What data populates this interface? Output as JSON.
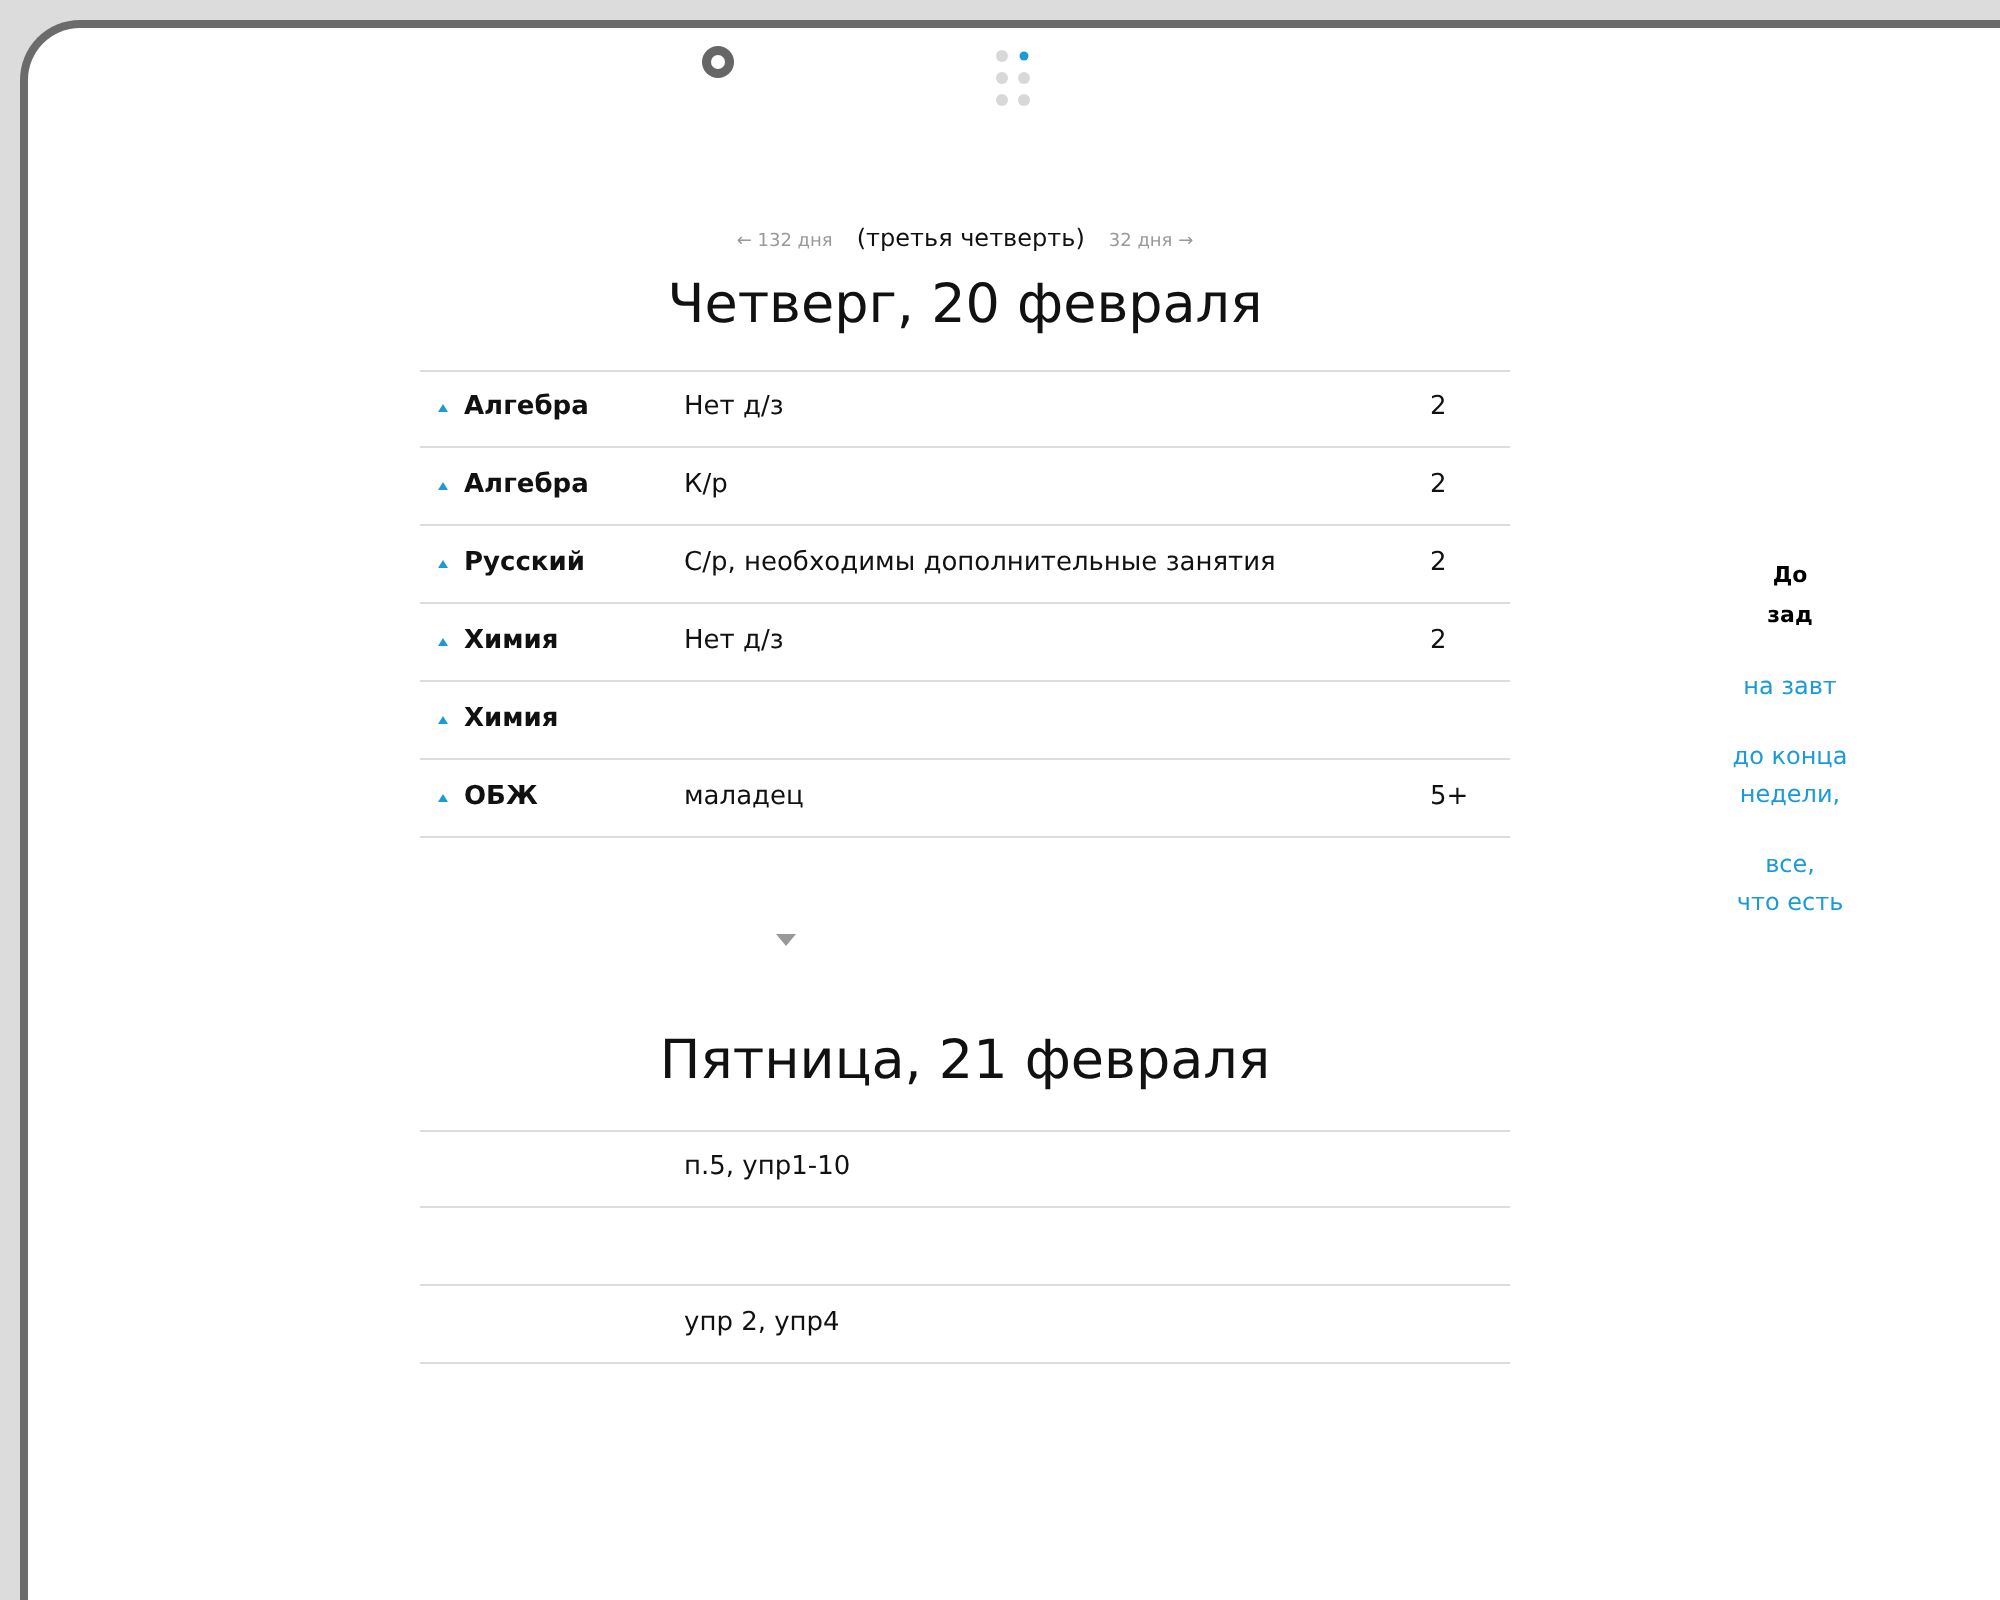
{
  "page_dots": [
    {
      "selected": false
    },
    {
      "selected": true
    },
    {
      "selected": false
    },
    {
      "selected": false
    },
    {
      "selected": false
    },
    {
      "selected": false
    }
  ],
  "nav": {
    "prev": "← 132 дня",
    "term": "(третья четверть)",
    "next": "32 дня →"
  },
  "days": [
    {
      "title": "Четверг, 20 февраля",
      "rows": [
        {
          "subject": "Алгебра",
          "homework": "Нет д/з",
          "grade": "2"
        },
        {
          "subject": "Алгебра",
          "homework": "К/р",
          "grade": "2"
        },
        {
          "subject": "Русский",
          "homework": "С/р, необходимы дополнительные занятия",
          "grade": "2"
        },
        {
          "subject": "Химия",
          "homework": "Нет д/з",
          "grade": "2"
        },
        {
          "subject": "Химия"
        },
        {
          "subject": "ОБЖ",
          "homework": "маладец",
          "grade": "5+"
        }
      ]
    },
    {
      "title": "Пятница, 21 февраля",
      "rows": [
        {
          "homework": "п.5, упр1-10"
        },
        {},
        {
          "homework": "упр 2, упр4"
        }
      ]
    }
  ],
  "sidebar": {
    "title_lines": [
      "До",
      "зад"
    ],
    "links": [
      {
        "lines": [
          "на завт"
        ]
      },
      {
        "lines": [
          "до конца",
          "недели,"
        ]
      },
      {
        "lines": [
          "все,",
          "что есть"
        ]
      }
    ]
  }
}
